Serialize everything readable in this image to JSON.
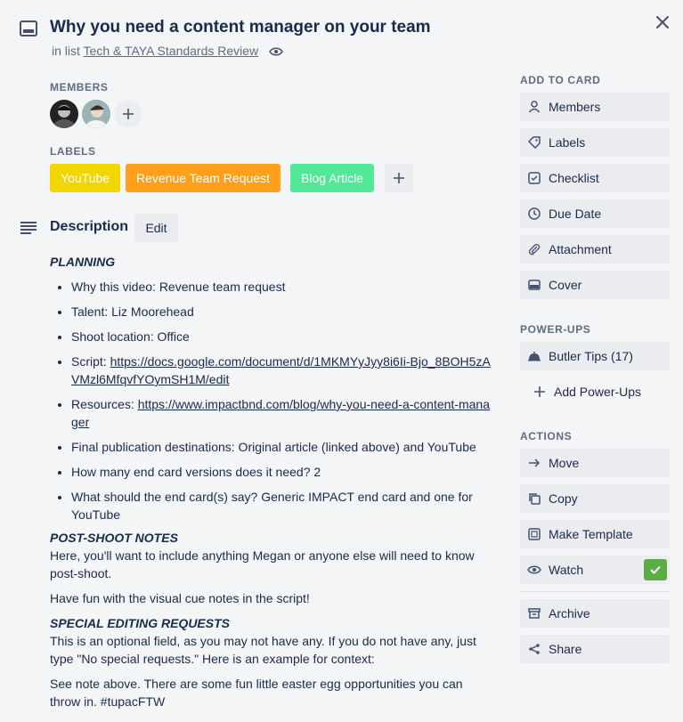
{
  "card": {
    "title": "Why you need a content manager on your team",
    "in_list_prefix": "in list",
    "list_name": "Tech & TAYA Standards Review"
  },
  "members": {
    "label": "MEMBERS"
  },
  "labels": {
    "label": "LABELS",
    "items": [
      {
        "text": "YouTube",
        "color": "#f2d600"
      },
      {
        "text": "Revenue Team Request",
        "color": "#ff9f1a"
      },
      {
        "text": "Blog Article",
        "color": "#51e898"
      }
    ]
  },
  "description": {
    "heading": "Description",
    "edit_label": "Edit",
    "planning_heading": "PLANNING",
    "bullets": [
      {
        "text": "Why this video: Revenue team request"
      },
      {
        "text": "Talent: Liz Moorehead"
      },
      {
        "text": "Shoot location: Office"
      },
      {
        "prefix": "Script: ",
        "link": "https://docs.google.com/document/d/1MKMYyJyy8i6Ii-Bjo_8BOH5zAVMzl6MfqvfYOymSH1M/edit"
      },
      {
        "prefix": "Resources: ",
        "link": "https://www.impactbnd.com/blog/why-you-need-a-content-manager"
      },
      {
        "text": "Final publication destinations: Original article (linked above) and YouTube"
      },
      {
        "text": "How many end card versions does it need? 2"
      },
      {
        "text": "What should the end card(s) say? Generic IMPACT end card and one for YouTube"
      }
    ],
    "post_shoot_heading": "POST-SHOOT NOTES",
    "post_shoot_text": "Here, you'll want to include anything Megan or anyone else will need to know post-shoot.",
    "fun_text": "Have fun with the visual cue notes in the script!",
    "special_heading": "SPECIAL EDITING REQUESTS",
    "special_text": "This is an optional field, as you may not have any. If you do not have any, just type \"No special requests.\" Here is an example for context:",
    "note_text": "See note above. There are some fun little easter egg opportunities you can throw in. #tupacFTW"
  },
  "sidebar": {
    "add_to_card_label": "ADD TO CARD",
    "add_to_card": [
      {
        "label": "Members",
        "icon": "person-icon"
      },
      {
        "label": "Labels",
        "icon": "tag-icon"
      },
      {
        "label": "Checklist",
        "icon": "checkbox-icon"
      },
      {
        "label": "Due Date",
        "icon": "clock-icon"
      },
      {
        "label": "Attachment",
        "icon": "paperclip-icon"
      },
      {
        "label": "Cover",
        "icon": "cover-icon"
      }
    ],
    "power_ups_label": "POWER-UPS",
    "butler_label": "Butler Tips (17)",
    "add_power_ups_label": "Add Power-Ups",
    "actions_label": "ACTIONS",
    "actions": [
      {
        "label": "Move",
        "icon": "arrow-right-icon"
      },
      {
        "label": "Copy",
        "icon": "copy-icon"
      },
      {
        "label": "Make Template",
        "icon": "template-icon"
      },
      {
        "label": "Watch",
        "icon": "eye-icon"
      },
      {
        "label": "Archive",
        "icon": "archive-icon"
      },
      {
        "label": "Share",
        "icon": "share-icon"
      }
    ]
  },
  "colors": {
    "accent_green": "#5aac44",
    "button_bg": "#ebecf0"
  }
}
